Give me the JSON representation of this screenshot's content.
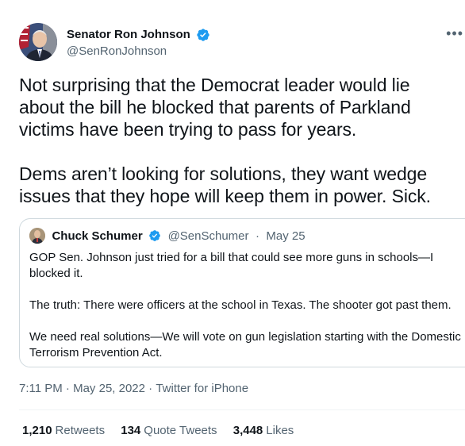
{
  "author": {
    "display_name": "Senator Ron Johnson",
    "handle": "@SenRonJohnson",
    "verified_icon": "verified-badge-icon",
    "avatar_icon": "avatar"
  },
  "more_icon": "more-options-icon",
  "tweet": {
    "text": "Not surprising that the Democrat leader would lie about the bill he blocked that parents of Parkland victims have been trying to pass for years.\n\nDems aren’t looking for solutions, they want wedge issues that they hope will keep them in power. Sick."
  },
  "quoted_tweet": {
    "display_name": "Chuck Schumer",
    "handle": "@SenSchumer",
    "separator": "·",
    "date": "May 25",
    "paragraphs": [
      "GOP Sen. Johnson just tried for a bill that could see more guns in schools—I blocked it.",
      "The truth: There were officers at the school in Texas. The shooter got past them.",
      "We need real solutions—We will vote on gun legislation starting with the Domestic Terrorism Prevention Act."
    ]
  },
  "meta": {
    "time": "7:11 PM",
    "separator": " · ",
    "date": "May 25, 2022",
    "source": "Twitter for iPhone"
  },
  "stats": {
    "retweets_count": "1,210",
    "retweets_label": "Retweets",
    "quotes_count": "134",
    "quotes_label": "Quote Tweets",
    "likes_count": "3,448",
    "likes_label": "Likes"
  },
  "colors": {
    "text": "#0f1419",
    "secondary": "#536471",
    "verified": "#1d9bf0",
    "border": "#cfd9de"
  }
}
